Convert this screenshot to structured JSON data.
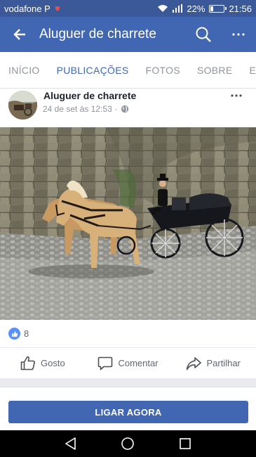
{
  "status_bar": {
    "carrier": "vodafone P",
    "battery_text": "22%",
    "battery_level": 0.22,
    "time": "21:56"
  },
  "app_bar": {
    "title": "Aluguer de charrete",
    "icons": [
      "back-arrow-icon",
      "search-icon",
      "more-vertical-icon"
    ]
  },
  "tabs": [
    {
      "label": "INÍCIO",
      "active": false
    },
    {
      "label": "PUBLICAÇÕES",
      "active": true
    },
    {
      "label": "FOTOS",
      "active": false
    },
    {
      "label": "SOBRE",
      "active": false
    },
    {
      "label": "EVEN",
      "active": false
    }
  ],
  "post": {
    "author": "Aluguer de charrete",
    "timestamp": "24 de set às 12:53",
    "separator": "·",
    "privacy_icon": "globe-icon",
    "like_count": "8",
    "actions": [
      {
        "label": "Gosto",
        "icon": "thumbs-up-icon"
      },
      {
        "label": "Comentar",
        "icon": "comment-icon"
      },
      {
        "label": "Partilhar",
        "icon": "share-icon"
      }
    ]
  },
  "cta": {
    "label": "LIGAR AGORA"
  },
  "colors": {
    "brand": "#4267b2",
    "status_bar": "#3b5998",
    "like_blue": "#5890ff"
  }
}
